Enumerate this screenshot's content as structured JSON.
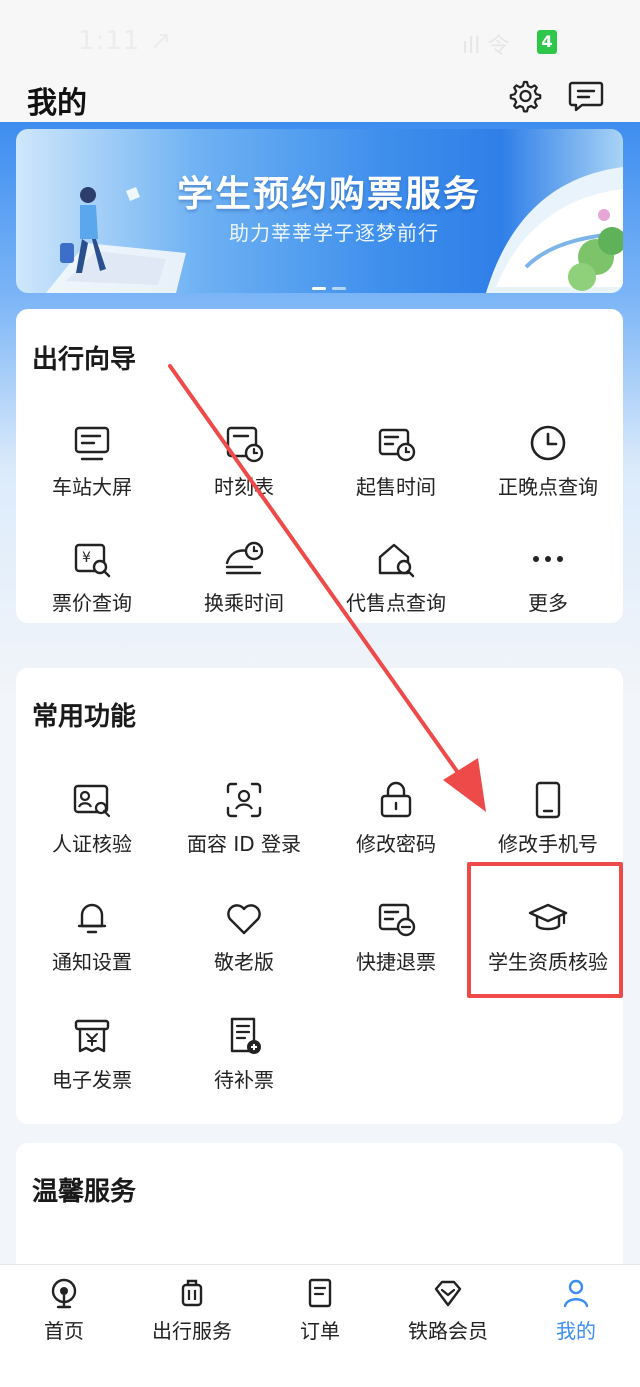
{
  "status_bar": {
    "time": "1:11 ↗",
    "signal": "ıll 令",
    "badge": "4"
  },
  "header": {
    "title": "我的"
  },
  "banner": {
    "title": "学生预约购票服务",
    "subtitle": "助力莘莘学子逐梦前行"
  },
  "travel_guide": {
    "title": "出行向导",
    "items": [
      {
        "label": "车站大屏",
        "icon": "station-screen-icon"
      },
      {
        "label": "时刻表",
        "icon": "timetable-icon"
      },
      {
        "label": "起售时间",
        "icon": "sale-time-icon"
      },
      {
        "label": "正晚点查询",
        "icon": "clock-icon"
      },
      {
        "label": "票价查询",
        "icon": "fare-search-icon"
      },
      {
        "label": "换乘时间",
        "icon": "transfer-time-icon"
      },
      {
        "label": "代售点查询",
        "icon": "agency-search-icon"
      },
      {
        "label": "更多",
        "icon": "more-icon"
      }
    ]
  },
  "common_functions": {
    "title": "常用功能",
    "items": [
      {
        "label": "人证核验",
        "icon": "id-verify-icon"
      },
      {
        "label": "面容 ID 登录",
        "icon": "face-id-icon"
      },
      {
        "label": "修改密码",
        "icon": "lock-icon"
      },
      {
        "label": "修改手机号",
        "icon": "phone-icon"
      },
      {
        "label": "通知设置",
        "icon": "bell-icon"
      },
      {
        "label": "敬老版",
        "icon": "heart-icon"
      },
      {
        "label": "快捷退票",
        "icon": "refund-ticket-icon"
      },
      {
        "label": "学生资质核验",
        "icon": "graduation-cap-icon"
      },
      {
        "label": "电子发票",
        "icon": "invoice-icon"
      },
      {
        "label": "待补票",
        "icon": "supplement-ticket-icon"
      }
    ]
  },
  "warm_services": {
    "title": "温馨服务"
  },
  "tabbar": {
    "items": [
      {
        "label": "首页",
        "icon": "home-icon"
      },
      {
        "label": "出行服务",
        "icon": "luggage-icon"
      },
      {
        "label": "订单",
        "icon": "order-icon"
      },
      {
        "label": "铁路会员",
        "icon": "member-icon"
      },
      {
        "label": "我的",
        "icon": "user-icon"
      }
    ],
    "active": "我的"
  },
  "colors": {
    "accent": "#3b8ef0",
    "highlight": "#ef4a4a"
  }
}
